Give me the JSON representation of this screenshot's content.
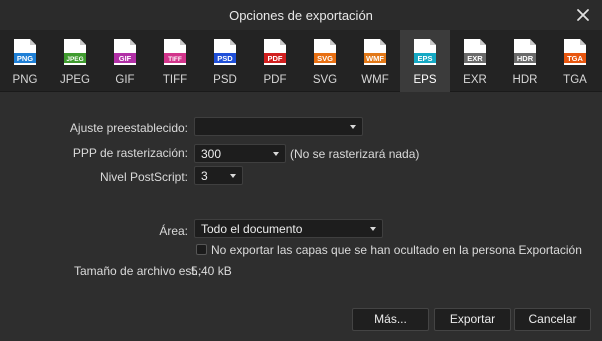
{
  "dialog": {
    "title": "Opciones de exportación",
    "close_icon": "close-icon"
  },
  "formats": [
    {
      "label": "PNG",
      "badge": "PNG",
      "color": "#1e7fd6"
    },
    {
      "label": "JPEG",
      "badge": "JPEG",
      "color": "#3f9b2e"
    },
    {
      "label": "GIF",
      "badge": "GIF",
      "color": "#b12fa6"
    },
    {
      "label": "TIFF",
      "badge": "TIFF",
      "color": "#d2348b"
    },
    {
      "label": "PSD",
      "badge": "PSD",
      "color": "#1f4fd8"
    },
    {
      "label": "PDF",
      "badge": "PDF",
      "color": "#d11f1f"
    },
    {
      "label": "SVG",
      "badge": "SVG",
      "color": "#e86f12"
    },
    {
      "label": "WMF",
      "badge": "WMF",
      "color": "#e27817"
    },
    {
      "label": "EPS",
      "badge": "EPS",
      "color": "#15a9c4",
      "active": true
    },
    {
      "label": "EXR",
      "badge": "EXR",
      "color": "#6a6a6a"
    },
    {
      "label": "HDR",
      "badge": "HDR",
      "color": "#6a6a6a"
    },
    {
      "label": "TGA",
      "badge": "TGA",
      "color": "#e8560f"
    }
  ],
  "settings": {
    "preset_label": "Ajuste preestablecido:",
    "preset_value": "",
    "dpi_label": "PPP de rasterización:",
    "dpi_value": "300",
    "dpi_note": "(No se rasterizará nada)",
    "postscript_label": "Nivel PostScript:",
    "postscript_value": "3",
    "area_label": "Área:",
    "area_value": "Todo el documento",
    "hidden_layers_label": "No exportar las capas que se han ocultado en la persona Exportación",
    "hidden_layers_checked": false,
    "filesize_label": "Tamaño de archivo est.:",
    "filesize_value": "5,40 kB"
  },
  "buttons": {
    "more": "Más...",
    "export": "Exportar",
    "cancel": "Cancelar"
  }
}
